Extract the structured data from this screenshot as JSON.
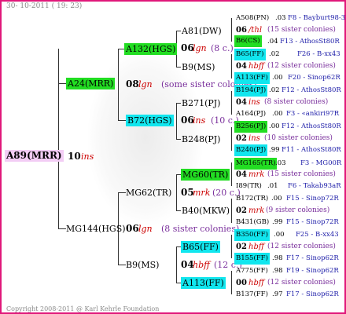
{
  "header": "30- 10-2011 ( 19: 23)",
  "footer": "Copyright 2008-2011 @ Karl Kehrle Foundation",
  "root": {
    "id": "A89(MRR)",
    "year": "10",
    "race": "ins"
  },
  "g1": [
    {
      "id": "A24(MRR)",
      "year": "08",
      "race": "lgn",
      "note": "(some sister colonies)"
    },
    {
      "id": "MG144(HGS)",
      "year": "06",
      "race": "lgn",
      "note": "(8 sister colonies)"
    }
  ],
  "g2": [
    {
      "id": "A132(HGS)",
      "year": "06",
      "race": "lgn",
      "note": "(8 c.)"
    },
    {
      "id": "B72(HGS)",
      "year": "06",
      "race": "ins",
      "note": "(10 c.)"
    },
    {
      "id": "MG62(TR)",
      "year": "05",
      "race": "mrk",
      "note": "(20 c.)"
    },
    {
      "id": "B9(MS)",
      "year": "04",
      "race": "hbff",
      "note": "(12 c.)"
    }
  ],
  "g3": [
    {
      "id": "A81(DW)"
    },
    {
      "id": "B9(MS)"
    },
    {
      "id": "B271(PJ)"
    },
    {
      "id": "B248(PJ)"
    },
    {
      "id": "MG60(TR)"
    },
    {
      "id": "I89(TR)"
    },
    {
      "id": "B40(MKW)"
    },
    {
      "id": "B65(FF)"
    },
    {
      "id": "A113(FF)"
    }
  ],
  "rows": [
    {
      "id": "A508(PN)",
      "year": ".03",
      "loc": "F8 - Bayburt98-3R"
    },
    {
      "year": "06",
      "race": "/thl",
      "note": "(15 sister colonies)"
    },
    {
      "id": "B6(CS)",
      "year": ".04",
      "loc": "F13 - AthosSt80R"
    },
    {
      "id": "B65(FF)",
      "year": ".02",
      "loc": "F26 - B-xx43"
    },
    {
      "year": "04",
      "race": "hbff",
      "note": "(12 sister colonies)"
    },
    {
      "id": "A113(FF)",
      "year": ".00",
      "loc": "F20 - Sinop62R"
    },
    {
      "id": "B194(PJ)",
      "year": ".02",
      "loc": "F12 - AthosSt80R"
    },
    {
      "year": "04",
      "race": "ins",
      "note": "(8 sister colonies)"
    },
    {
      "id": "A164(PJ)",
      "year": ".00",
      "loc": "F3 - «ankiri97R"
    },
    {
      "id": "B256(PJ)",
      "year": ".00",
      "loc": "F12 - AthosSt80R"
    },
    {
      "year": "02",
      "race": "ins",
      "note": "(10 sister colonies)"
    },
    {
      "id": "B240(PJ)",
      "year": ".99",
      "loc": "F11 - AthosSt80R"
    },
    {
      "id": "MG165(TR)",
      "year": ".03",
      "loc": "F3 - MG00R"
    },
    {
      "year": "04",
      "race": "mrk",
      "note": "(15 sister colonies)"
    },
    {
      "id": "I89(TR)",
      "year": ".01",
      "loc": "F6 - Takab93aR"
    },
    {
      "id": "B172(TR)",
      "year": ".00",
      "loc": "F15 - Sinop72R"
    },
    {
      "year": "02",
      "race": "mrk",
      "note": "(9 sister colonies)"
    },
    {
      "id": "B431(GB)",
      "year": ".99",
      "loc": "F15 - Sinop72R"
    },
    {
      "id": "B350(FF)",
      "year": ".00",
      "loc": "F25 - B-xx43"
    },
    {
      "year": "02",
      "race": "hbff",
      "note": "(12 sister colonies)"
    },
    {
      "id": "B155(FF)",
      "year": ".98",
      "loc": "F17 - Sinop62R"
    },
    {
      "id": "A775(FF)",
      "year": ".98",
      "loc": "F19 - Sinop62R"
    },
    {
      "year": "00",
      "race": "hbff",
      "note": "(12 sister colonies)"
    },
    {
      "id": "B137(FF)",
      "year": ".97",
      "loc": "F17 - Sinop62R"
    }
  ]
}
